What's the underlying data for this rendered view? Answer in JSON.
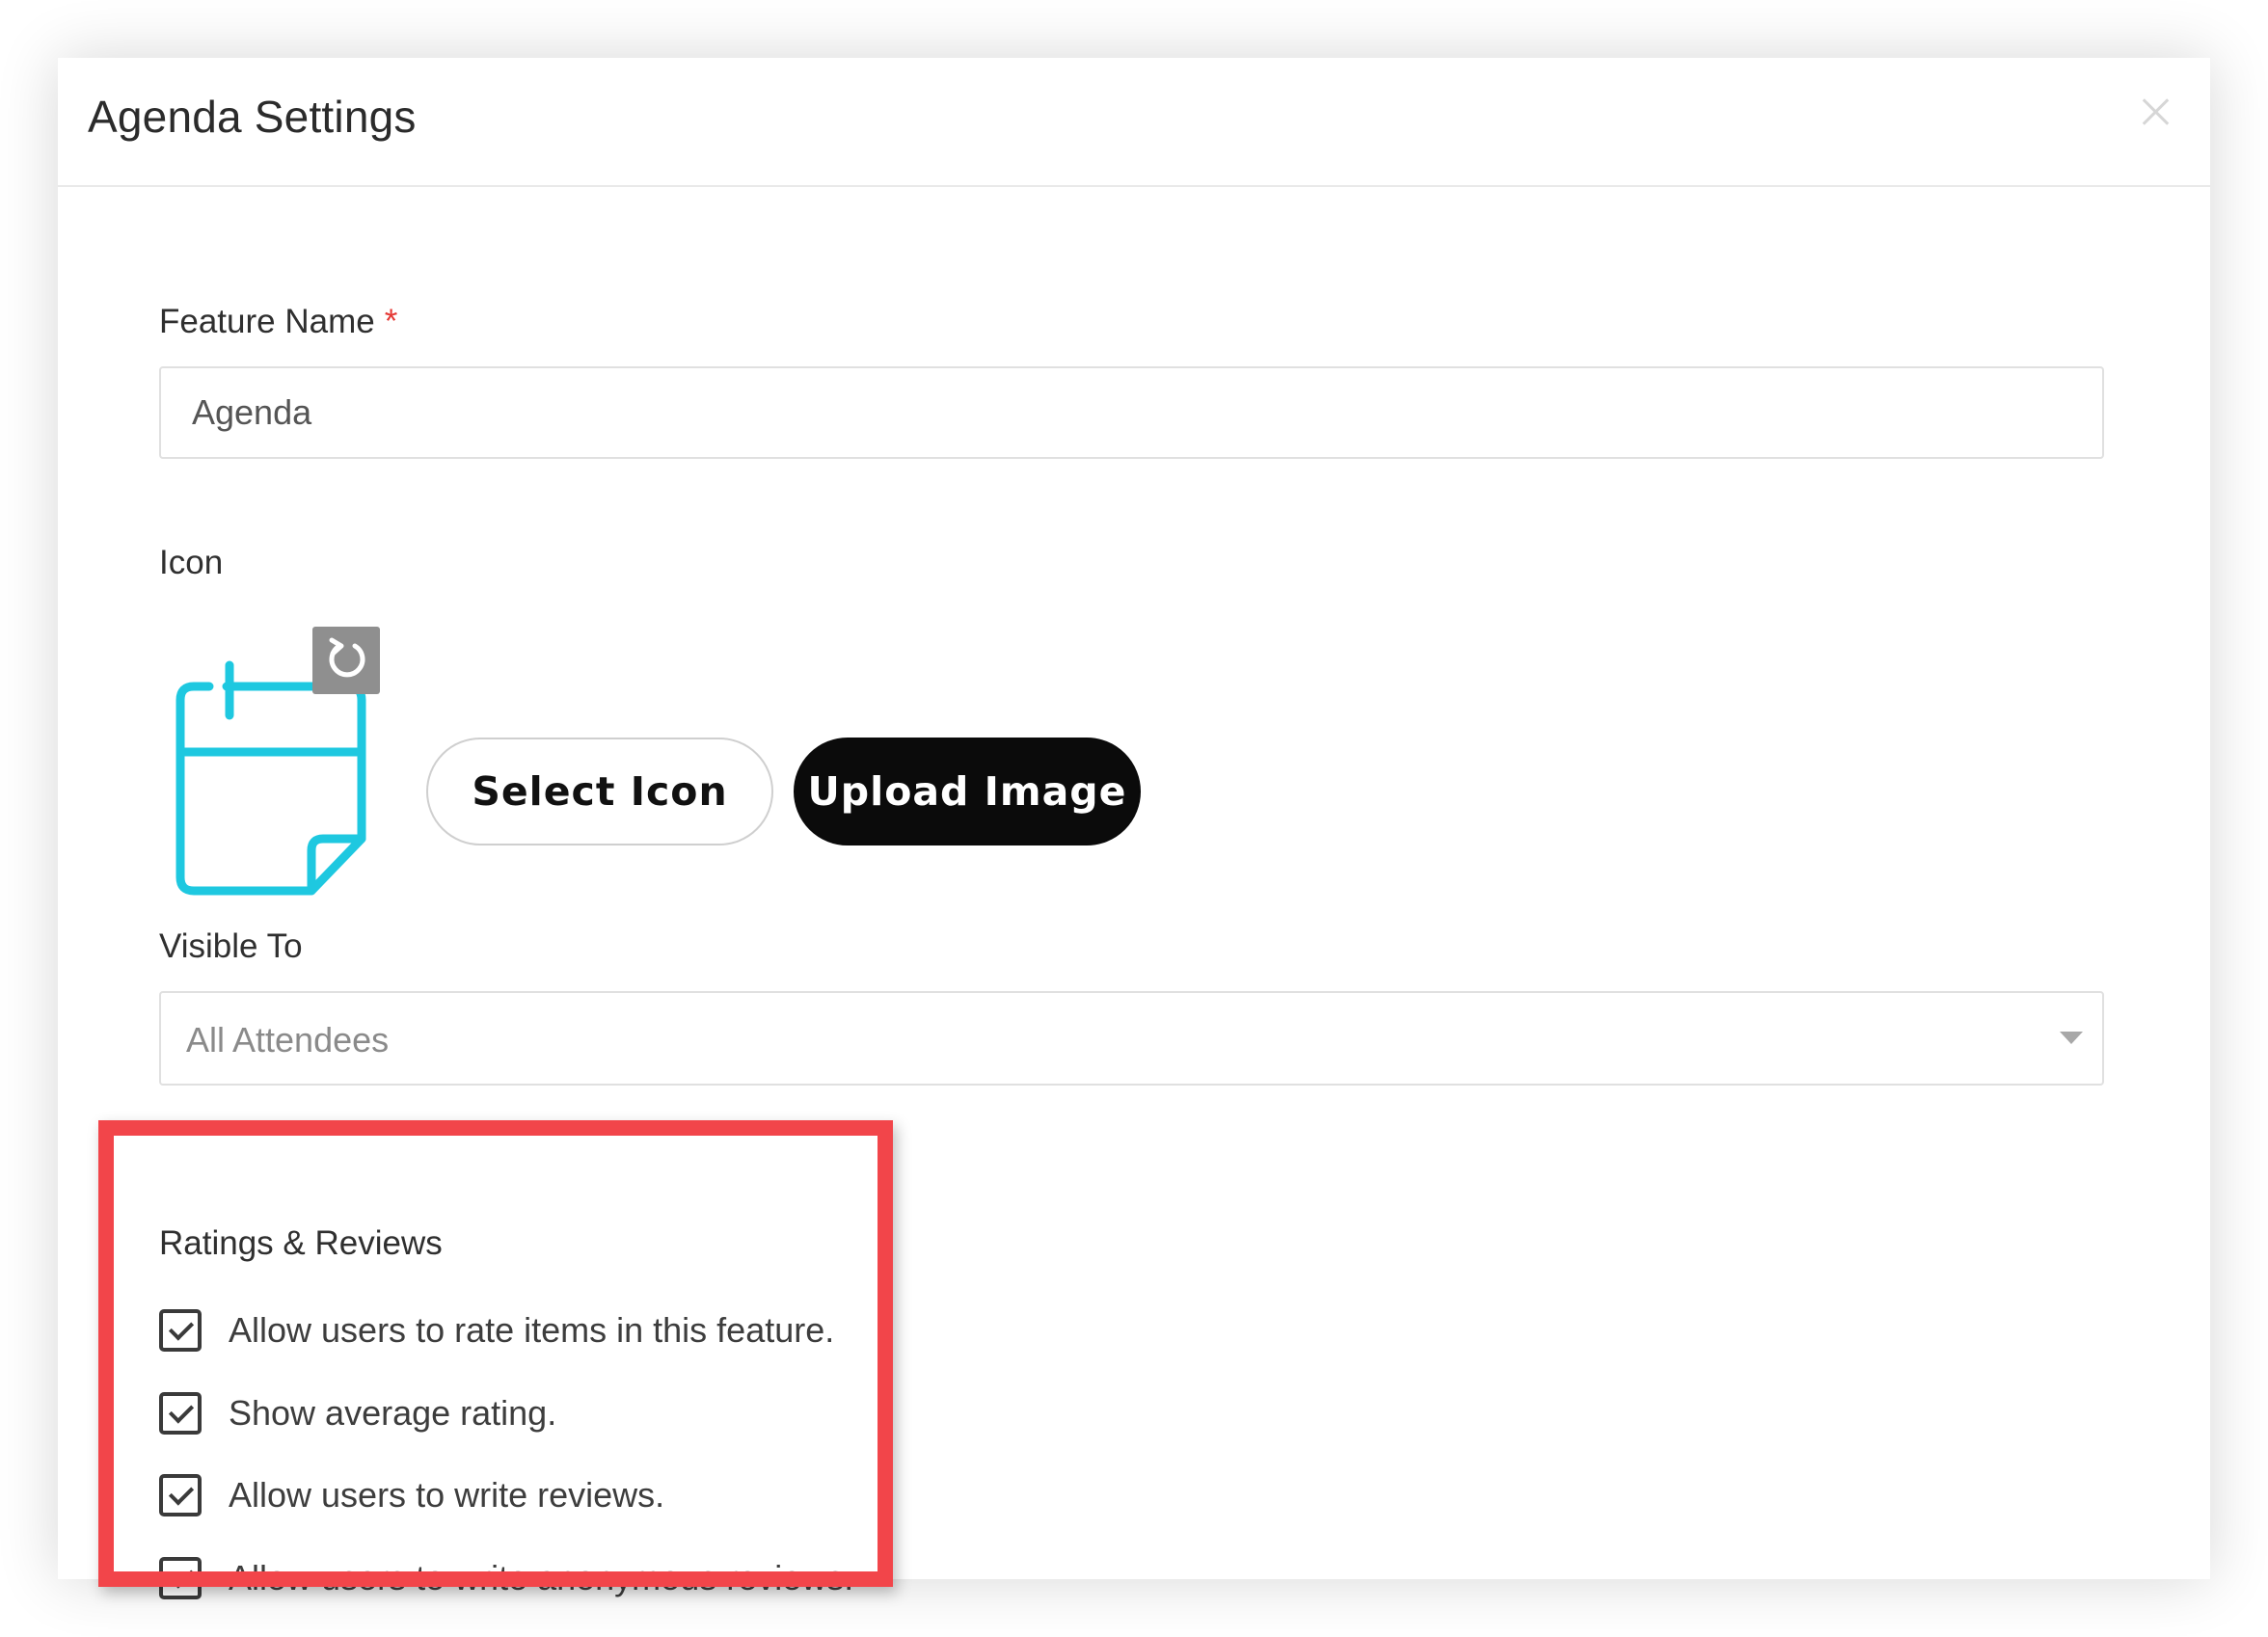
{
  "modal": {
    "title": "Agenda Settings",
    "close_icon": "close-icon"
  },
  "feature_name": {
    "label": "Feature Name",
    "required_mark": "*",
    "value": "Agenda"
  },
  "icon_section": {
    "label": "Icon",
    "preview_icon": "calendar-icon",
    "preview_color": "#1ec8e0",
    "reset_icon": "reset-icon",
    "select_button_label": "Select Icon",
    "upload_button_label": "Upload Image"
  },
  "visible_to": {
    "label": "Visible To",
    "selected": "All Attendees"
  },
  "ratings_reviews": {
    "title": "Ratings & Reviews",
    "highlight_color": "#f2454a",
    "options": [
      {
        "label": "Allow users to rate items in this feature.",
        "checked": true
      },
      {
        "label": "Show average rating.",
        "checked": true
      },
      {
        "label": "Allow users to write reviews.",
        "checked": true
      },
      {
        "label": "Allow users to write anonymous reviews.",
        "checked": true
      }
    ]
  }
}
